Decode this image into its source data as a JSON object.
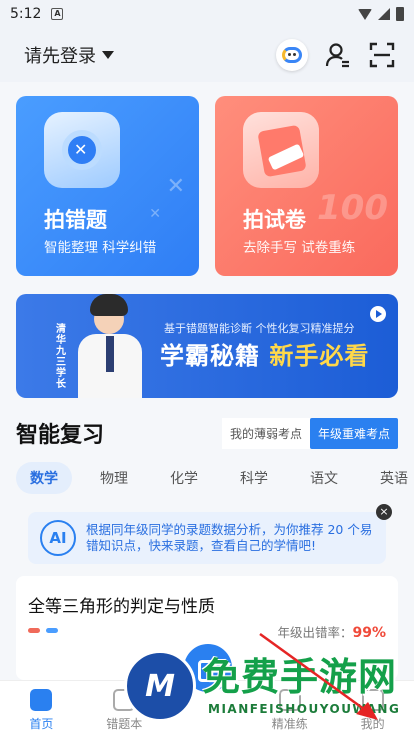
{
  "status_bar": {
    "time": "5:12",
    "notification_icon": "A"
  },
  "header": {
    "login_label": "请先登录",
    "icons": [
      "robot-icon",
      "user-icon",
      "scan-icon"
    ]
  },
  "cards": [
    {
      "title": "拍错题",
      "subtitle": "智能整理 科学纠错"
    },
    {
      "title": "拍试卷",
      "subtitle": "去除手写 试卷重练",
      "deco": "100"
    }
  ],
  "banner": {
    "side_text": "清华九三学长",
    "line1": "基于错题智能诊断 个性化复习精准提分",
    "line2_a": "学霸秘籍",
    "line2_b": "新手必看"
  },
  "review": {
    "title": "智能复习",
    "segments": [
      {
        "label": "我的薄弱考点",
        "active": false
      },
      {
        "label": "年级重难考点",
        "active": true
      }
    ]
  },
  "subjects": [
    {
      "label": "数学",
      "active": true
    },
    {
      "label": "物理",
      "active": false
    },
    {
      "label": "化学",
      "active": false
    },
    {
      "label": "科学",
      "active": false
    },
    {
      "label": "语文",
      "active": false
    },
    {
      "label": "英语",
      "active": false
    }
  ],
  "tip": {
    "badge": "AI",
    "text": "根据同年级同学的录题数据分析，为你推荐 20 个易错知识点，快来录题，查看自己的学情吧!",
    "close": "×"
  },
  "question": {
    "title": "全等三角形的判定与性质",
    "rate_label": "年级出错率：",
    "rate_value": "99%",
    "dot_colors": [
      "#f06a5a",
      "#4a9dff"
    ]
  },
  "tabs": [
    {
      "label": "首页",
      "active": true
    },
    {
      "label": "错题本",
      "active": false
    },
    {
      "label": "",
      "active": false
    },
    {
      "label": "精准练",
      "active": false
    },
    {
      "label": "我的",
      "active": false
    }
  ],
  "watermark": {
    "logo": "M",
    "text": "免费手游网",
    "sub": "MIANFEISHOUYOUWANG"
  },
  "colors": {
    "primary": "#2a80f0",
    "danger": "#f04a3a",
    "card_blue": "#3a8bf8",
    "card_red": "#fb7464"
  }
}
